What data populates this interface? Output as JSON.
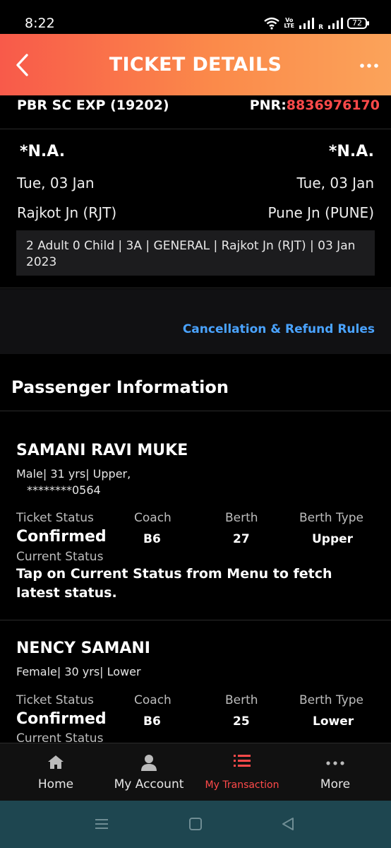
{
  "status_bar": {
    "time": "8:22",
    "volte_top": "Vo",
    "volte_bottom": "LTE",
    "roaming": "R",
    "battery": "72"
  },
  "header": {
    "title": "TICKET DETAILS"
  },
  "train": {
    "name": "PBR SC EXP  (19202)",
    "pnr_label": "PNR:",
    "pnr_value": "8836976170"
  },
  "journey": {
    "from_time": "*N.A.",
    "to_time": "*N.A.",
    "from_date": "Tue, 03 Jan",
    "to_date": "Tue, 03 Jan",
    "from_station": "Rajkot Jn (RJT)",
    "to_station": "Pune Jn (PUNE)",
    "summary": "2 Adult 0 Child  | 3A | GENERAL | Rajkot Jn (RJT) | 03 Jan 2023"
  },
  "rules_link": "Cancellation & Refund Rules",
  "passenger_section": {
    "heading": "Passenger Information",
    "columns": {
      "status": "Ticket Status",
      "coach": "Coach",
      "berth": "Berth",
      "berth_type": "Berth Type",
      "current": "Current Status"
    },
    "passengers": [
      {
        "name": "SAMANI RAVI MUKE",
        "meta": "Male| 31 yrs| Upper,",
        "id": "********0564",
        "status": "Confirmed",
        "coach": "B6",
        "berth": "27",
        "berth_type": "Upper",
        "current_msg": "Tap on Current Status from Menu to fetch latest status."
      },
      {
        "name": "NENCY SAMANI",
        "meta": "Female| 30 yrs| Lower",
        "status": "Confirmed",
        "coach": "B6",
        "berth": "25",
        "berth_type": "Lower"
      }
    ]
  },
  "bottom_nav": {
    "items": [
      {
        "label": "Home",
        "icon": "home-icon"
      },
      {
        "label": "My Account",
        "icon": "person-icon"
      },
      {
        "label": "My Transaction",
        "icon": "transaction-list-icon",
        "active": true
      },
      {
        "label": "More",
        "icon": "more-dots-icon"
      }
    ]
  },
  "colors": {
    "accent": "#ff4a4a",
    "link": "#4aa3ff",
    "header_start": "#f85a4a",
    "header_end": "#fba35a",
    "system_nav": "#1e4650"
  }
}
